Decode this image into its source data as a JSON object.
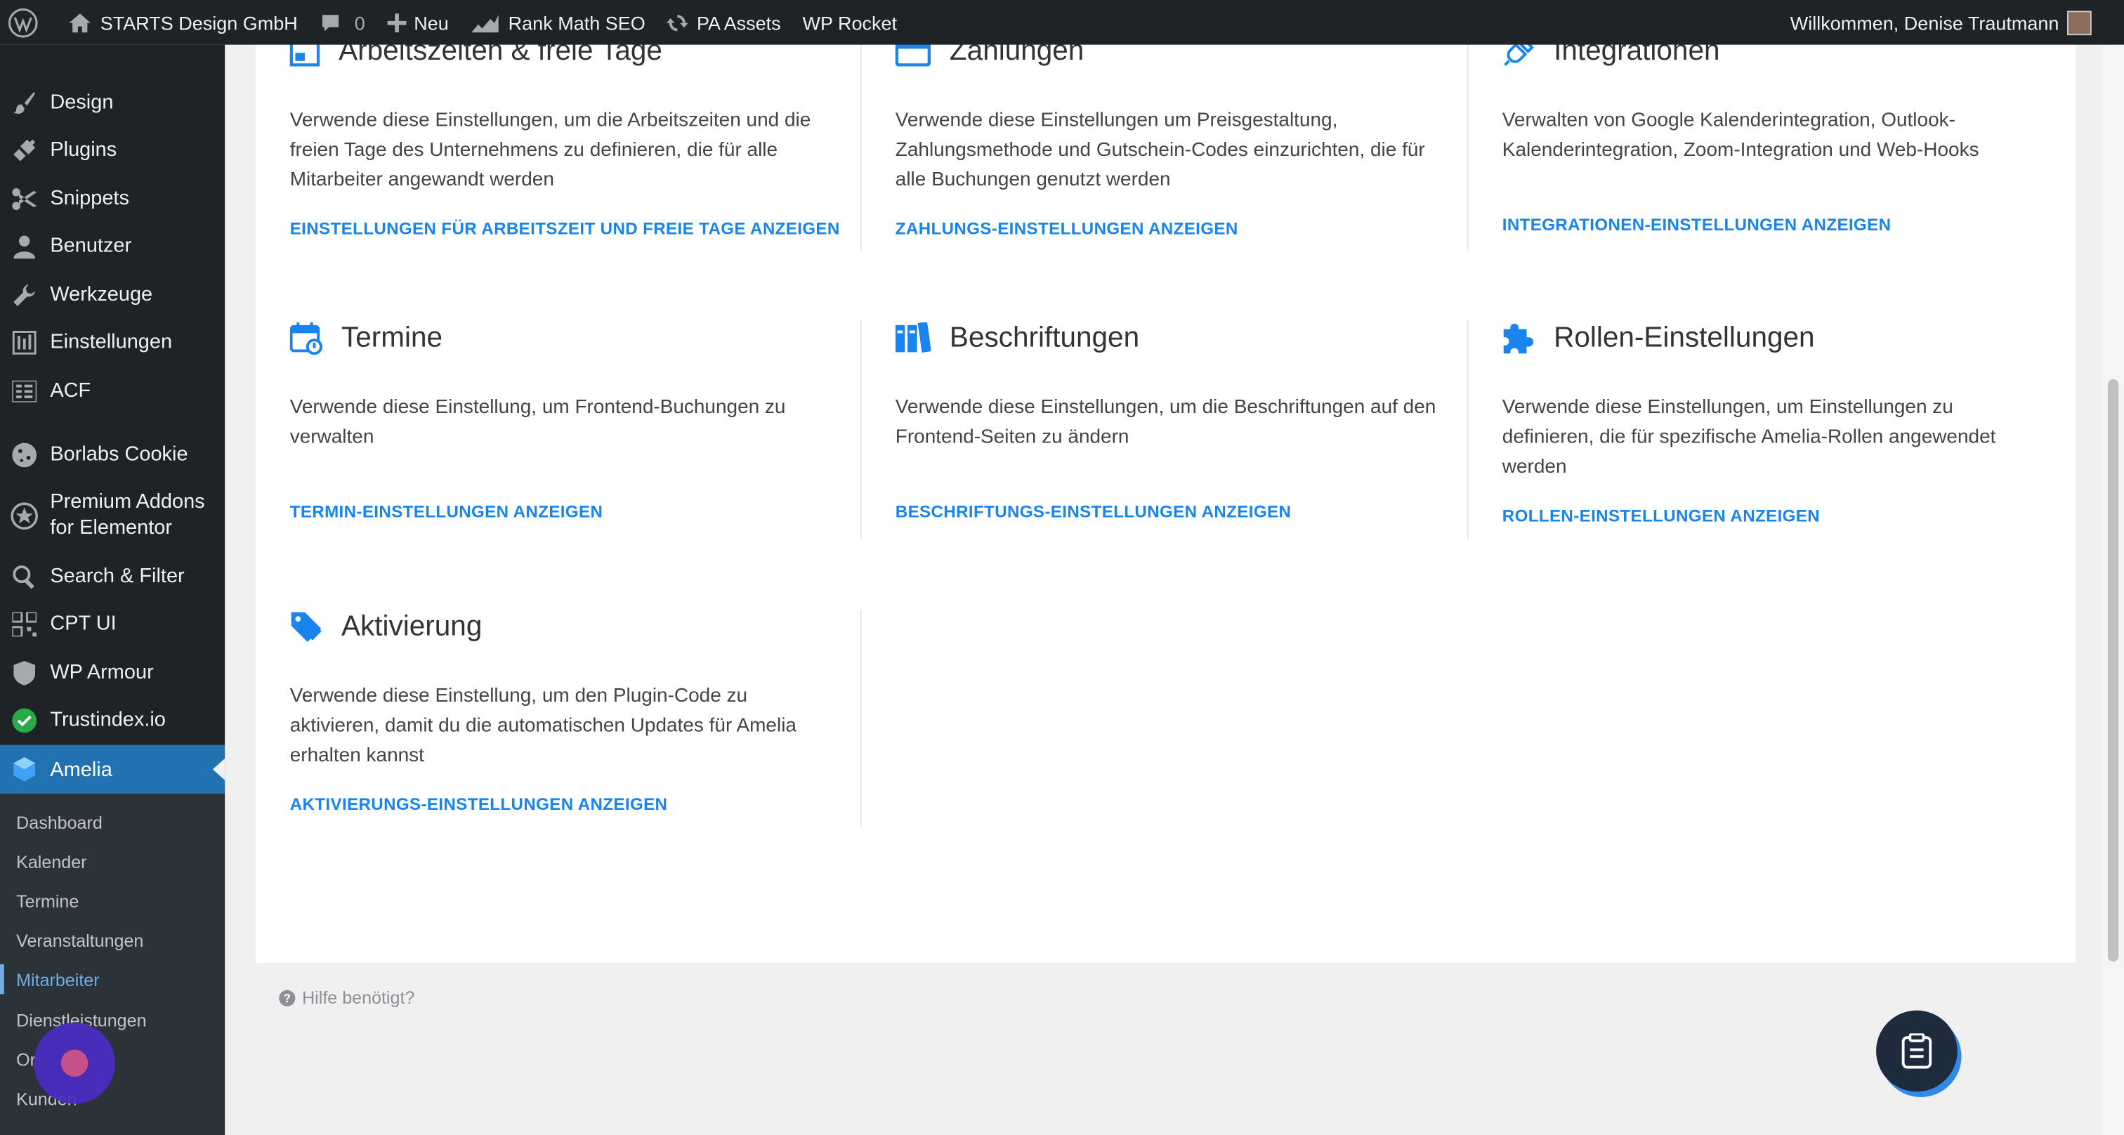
{
  "adminbar": {
    "site_name": "STARTS Design GmbH",
    "comments_count": "0",
    "new_label": "Neu",
    "rank_math": "Rank Math SEO",
    "pa_assets": "PA Assets",
    "wp_rocket": "WP Rocket",
    "welcome": "Willkommen, Denise Trautmann"
  },
  "sidebar": {
    "items": [
      {
        "label": "Design",
        "icon": "brush-icon"
      },
      {
        "label": "Plugins",
        "icon": "plug-icon"
      },
      {
        "label": "Snippets",
        "icon": "scissors-icon"
      },
      {
        "label": "Benutzer",
        "icon": "user-icon"
      },
      {
        "label": "Werkzeuge",
        "icon": "wrench-icon"
      },
      {
        "label": "Einstellungen",
        "icon": "sliders-icon"
      },
      {
        "label": "ACF",
        "icon": "grid-icon"
      },
      {
        "label": "Borlabs Cookie",
        "icon": "cookie-icon"
      },
      {
        "label": "Premium Addons for Elementor",
        "icon": "star-icon"
      },
      {
        "label": "Search & Filter",
        "icon": "search-icon"
      },
      {
        "label": "CPT UI",
        "icon": "qr-icon"
      },
      {
        "label": "WP Armour",
        "icon": "shield-icon"
      },
      {
        "label": "Trustindex.io",
        "icon": "check-circle-icon"
      },
      {
        "label": "Amelia",
        "icon": "amelia-icon"
      }
    ],
    "submenu": [
      "Dashboard",
      "Kalender",
      "Termine",
      "Veranstaltungen",
      "Mitarbeiter",
      "Dienstleistungen",
      "Or",
      "Kunden"
    ]
  },
  "cards": [
    {
      "title": "Arbeitszeiten & freie Tage",
      "desc": "Verwende diese Einstellungen, um die Arbeitszeiten und die freien Tage des Unternehmens zu definieren, die für alle Mitarbeiter angewandt werden",
      "link": "EINSTELLUNGEN FÜR ARBEITSZEIT UND FREIE TAGE ANZEIGEN"
    },
    {
      "title": "Zahlungen",
      "desc": "Verwende diese Einstellungen um Preisgestaltung, Zahlungsmethode und Gutschein-Codes einzurichten, die für alle Buchungen genutzt werden",
      "link": "ZAHLUNGS-EINSTELLUNGEN ANZEIGEN"
    },
    {
      "title": "Integrationen",
      "desc": "Verwalten von Google Kalenderintegration, Outlook-Kalenderintegration, Zoom-Integration und Web-Hooks",
      "link": "INTEGRATIONEN-EINSTELLUNGEN ANZEIGEN"
    },
    {
      "title": "Termine",
      "desc": "Verwende diese Einstellung, um Frontend-Buchungen zu verwalten",
      "link": "TERMIN-EINSTELLUNGEN ANZEIGEN"
    },
    {
      "title": "Beschriftungen",
      "desc": "Verwende diese Einstellungen, um die Beschriftungen auf den Frontend-Seiten zu ändern",
      "link": "BESCHRIFTUNGS-EINSTELLUNGEN ANZEIGEN"
    },
    {
      "title": "Rollen-Einstellungen",
      "desc": "Verwende diese Einstellungen, um Einstellungen zu definieren, die für spezifische Amelia-Rollen angewendet werden",
      "link": "ROLLEN-EINSTELLUNGEN ANZEIGEN"
    },
    {
      "title": "Aktivierung",
      "desc": "Verwende diese Einstellung, um den Plugin-Code zu aktivieren, damit du die automatischen Updates für Amelia erhalten kannst",
      "link": "AKTIVIERUNGS-EINSTELLUNGEN ANZEIGEN"
    }
  ],
  "help_text": "Hilfe benötigt?",
  "colors": {
    "accent": "#1a84ee",
    "admin_bg": "#1d2327",
    "active": "#2271b1"
  }
}
